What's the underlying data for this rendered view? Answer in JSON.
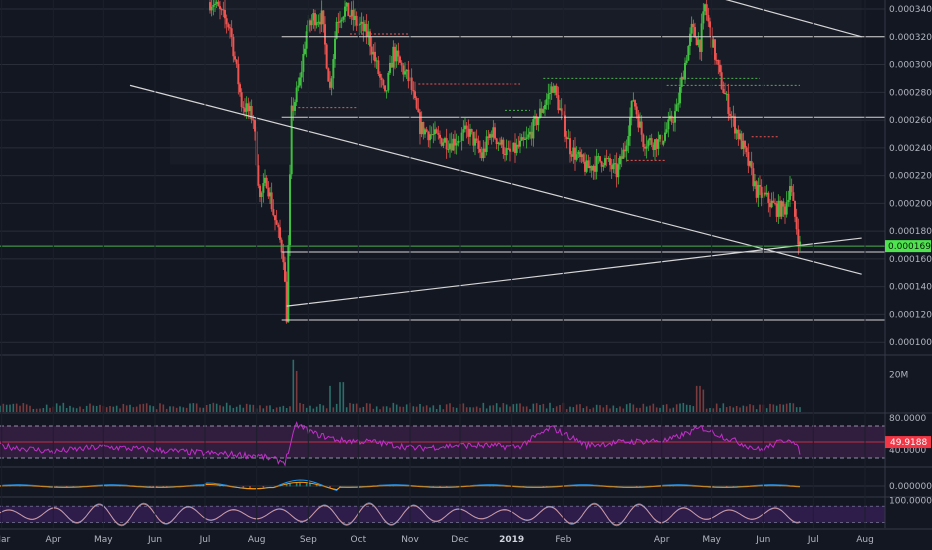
{
  "colors": {
    "background": "#131722",
    "panel_shade": "#181c27",
    "grid": "#2a2e39",
    "up": "#26a69a",
    "up_body": "#3fbf3f",
    "down": "#ef5350",
    "trendline": "#d6d6d6",
    "price_line": "#4caf50",
    "price_tag": "#4ee44e",
    "rsi_line": "#c130c9",
    "rsi_band": "#4a2356",
    "rsi_tag": "#f23645",
    "macd_line": "#2196f3",
    "signal_line": "#ff9800",
    "stoch_k": "#7b8ab8",
    "stoch_d": "#e0a0a0",
    "stoch_band": "#3b1f5c",
    "level_dotted_green": "#4caf50",
    "level_dotted_red": "#ef5350"
  },
  "chart_data": [
    {
      "type": "candlestick",
      "panel": "price",
      "y_ticks": [
        "0.0003400",
        "0.0003200",
        "0.0003000",
        "0.0002800",
        "0.0002600",
        "0.0002400",
        "0.0002200",
        "0.0002000",
        "0.0001800",
        "0.0001600",
        "0.0001400",
        "0.0001200",
        "0.0001000"
      ],
      "y_tick_values": [
        0.00034,
        0.00032,
        0.0003,
        0.00028,
        0.00026,
        0.00024,
        0.00022,
        0.0002,
        0.00018,
        0.00016,
        0.00014,
        0.00012,
        0.0001
      ],
      "ylim": [
        9.15e-05,
        0.0003465
      ],
      "current_price_label": "0.0001692",
      "current_price": 0.0001692,
      "close_series": [
        {
          "x": "2018-07-06",
          "y": 0.000345
        },
        {
          "x": "2018-07-16",
          "y": 0.000327
        },
        {
          "x": "2018-07-23",
          "y": 0.000272
        },
        {
          "x": "2018-07-30",
          "y": 0.000262
        },
        {
          "x": "2018-08-03",
          "y": 0.000203
        },
        {
          "x": "2018-08-07",
          "y": 0.000217
        },
        {
          "x": "2018-08-11",
          "y": 0.000193
        },
        {
          "x": "2018-08-17",
          "y": 0.000163
        },
        {
          "x": "2018-08-19",
          "y": 0.000119
        },
        {
          "x": "2018-08-22",
          "y": 0.000265
        },
        {
          "x": "2018-08-27",
          "y": 0.000288
        },
        {
          "x": "2018-08-31",
          "y": 0.000324
        },
        {
          "x": "2018-09-04",
          "y": 0.000334
        },
        {
          "x": "2018-09-09",
          "y": 0.000334
        },
        {
          "x": "2018-09-14",
          "y": 0.000282
        },
        {
          "x": "2018-09-18",
          "y": 0.000332
        },
        {
          "x": "2018-09-23",
          "y": 0.00034
        },
        {
          "x": "2018-09-30",
          "y": 0.00033
        },
        {
          "x": "2018-10-07",
          "y": 0.000321
        },
        {
          "x": "2018-10-17",
          "y": 0.000276
        },
        {
          "x": "2018-10-22",
          "y": 0.000309
        },
        {
          "x": "2018-11-01",
          "y": 0.000287
        },
        {
          "x": "2018-11-07",
          "y": 0.000255
        },
        {
          "x": "2018-11-17",
          "y": 0.000247
        },
        {
          "x": "2018-11-26",
          "y": 0.000244
        },
        {
          "x": "2018-12-06",
          "y": 0.000252
        },
        {
          "x": "2018-12-14",
          "y": 0.000234
        },
        {
          "x": "2018-12-20",
          "y": 0.000252
        },
        {
          "x": "2018-12-30",
          "y": 0.000235
        },
        {
          "x": "2019-01-10",
          "y": 0.000245
        },
        {
          "x": "2019-01-20",
          "y": 0.00027
        },
        {
          "x": "2019-01-26",
          "y": 0.000285
        },
        {
          "x": "2019-02-05",
          "y": 0.00024
        },
        {
          "x": "2019-02-15",
          "y": 0.000225
        },
        {
          "x": "2019-02-25",
          "y": 0.000232
        },
        {
          "x": "2019-03-05",
          "y": 0.000222
        },
        {
          "x": "2019-03-10",
          "y": 0.00024
        },
        {
          "x": "2019-03-15",
          "y": 0.000276
        },
        {
          "x": "2019-03-21",
          "y": 0.000245
        },
        {
          "x": "2019-03-31",
          "y": 0.000244
        },
        {
          "x": "2019-04-10",
          "y": 0.000267
        },
        {
          "x": "2019-04-14",
          "y": 0.000295
        },
        {
          "x": "2019-04-19",
          "y": 0.000325
        },
        {
          "x": "2019-04-24",
          "y": 0.000315
        },
        {
          "x": "2019-04-27",
          "y": 0.000342
        },
        {
          "x": "2019-05-01",
          "y": 0.000318
        },
        {
          "x": "2019-05-06",
          "y": 0.00029
        },
        {
          "x": "2019-05-13",
          "y": 0.000262
        },
        {
          "x": "2019-05-20",
          "y": 0.00024
        },
        {
          "x": "2019-05-24",
          "y": 0.000225
        },
        {
          "x": "2019-05-28",
          "y": 0.000209
        },
        {
          "x": "2019-06-03",
          "y": 0.000203
        },
        {
          "x": "2019-06-09",
          "y": 0.000196
        },
        {
          "x": "2019-06-14",
          "y": 0.000196
        },
        {
          "x": "2019-06-17",
          "y": 0.000214
        },
        {
          "x": "2019-06-19",
          "y": 0.000197
        },
        {
          "x": "2019-06-23",
          "y": 0.0001692
        }
      ],
      "horizontal_levels": [
        0.00032,
        0.000262,
        0.000165,
        0.000116
      ],
      "dotted_levels": [
        {
          "from": "2018-11-06",
          "to": "2019-01-06",
          "y": 0.000286,
          "color": "red"
        },
        {
          "from": "2018-12-28",
          "to": "2019-01-12",
          "y": 0.000267,
          "color": "green"
        },
        {
          "from": "2019-01-20",
          "to": "2019-05-30",
          "y": 0.00029,
          "color": "green"
        },
        {
          "from": "2019-04-04",
          "to": "2019-06-23",
          "y": 0.000285,
          "color": "green"
        },
        {
          "from": "2019-03-11",
          "to": "2019-04-04",
          "y": 0.000231,
          "color": "red"
        },
        {
          "from": "2018-08-26",
          "to": "2018-09-30",
          "y": 0.000269,
          "color": "red"
        },
        {
          "from": "2018-09-26",
          "to": "2018-10-31",
          "y": 0.000322,
          "color": "red"
        },
        {
          "from": "2019-05-25",
          "to": "2019-06-10",
          "y": 0.000248,
          "color": "red"
        }
      ],
      "trendlines": [
        {
          "from": {
            "x": "2018-05-17",
            "y": 0.000285
          },
          "to": {
            "x": "2019-07-30",
            "y": 0.000149
          }
        },
        {
          "from": {
            "x": "2018-08-19",
            "y": 0.000126
          },
          "to": {
            "x": "2019-07-30",
            "y": 0.000175
          }
        },
        {
          "from": {
            "x": "2019-05-06",
            "y": 0.000348
          },
          "to": {
            "x": "2019-07-30",
            "y": 0.00032
          }
        }
      ]
    },
    {
      "type": "bar",
      "panel": "volume",
      "y_ticks": [
        "20M"
      ],
      "y_tick_values": [
        20
      ],
      "ylim": [
        0,
        30
      ],
      "spikes": [
        {
          "x": "2018-08-23",
          "y": 28
        },
        {
          "x": "2018-08-25",
          "y": 22
        },
        {
          "x": "2018-09-14",
          "y": 14
        },
        {
          "x": "2018-09-21",
          "y": 16
        },
        {
          "x": "2019-04-23",
          "y": 14
        },
        {
          "x": "2019-04-26",
          "y": 12
        }
      ]
    },
    {
      "type": "line",
      "panel": "rsi",
      "y_ticks": [
        "80.0000",
        "40.0000"
      ],
      "y_tick_values": [
        80,
        40
      ],
      "band": [
        30,
        70
      ],
      "midline": 50,
      "ylim": [
        20,
        85
      ],
      "current_value_label": "49.9188",
      "current_value": 49.9188,
      "series": [
        {
          "x": "2018-03-01",
          "y": 45
        },
        {
          "x": "2018-04-01",
          "y": 38
        },
        {
          "x": "2018-05-01",
          "y": 44
        },
        {
          "x": "2018-06-01",
          "y": 40
        },
        {
          "x": "2018-07-01",
          "y": 36
        },
        {
          "x": "2018-08-01",
          "y": 33
        },
        {
          "x": "2018-08-18",
          "y": 25
        },
        {
          "x": "2018-08-25",
          "y": 72
        },
        {
          "x": "2018-09-05",
          "y": 60
        },
        {
          "x": "2018-09-20",
          "y": 52
        },
        {
          "x": "2018-10-10",
          "y": 50
        },
        {
          "x": "2018-11-05",
          "y": 42
        },
        {
          "x": "2018-12-01",
          "y": 46
        },
        {
          "x": "2019-01-05",
          "y": 44
        },
        {
          "x": "2019-01-25",
          "y": 68
        },
        {
          "x": "2019-02-15",
          "y": 46
        },
        {
          "x": "2019-03-10",
          "y": 50
        },
        {
          "x": "2019-04-05",
          "y": 52
        },
        {
          "x": "2019-04-25",
          "y": 68
        },
        {
          "x": "2019-05-10",
          "y": 55
        },
        {
          "x": "2019-05-30",
          "y": 40
        },
        {
          "x": "2019-06-17",
          "y": 55
        },
        {
          "x": "2019-06-23",
          "y": 38
        }
      ]
    },
    {
      "type": "line",
      "panel": "macd",
      "y_ticks": [
        "0.0000000"
      ],
      "y_tick_values": [
        0
      ],
      "ylim": [
        -1,
        1
      ]
    },
    {
      "type": "line",
      "panel": "stochastic",
      "y_ticks": [
        "100.0000"
      ],
      "y_tick_values": [
        100
      ],
      "ylim": [
        0,
        110
      ],
      "band": [
        20,
        80
      ]
    },
    {
      "type": "time_axis",
      "labels": [
        {
          "x": "2018-03-01",
          "label": "Mar"
        },
        {
          "x": "2018-04-01",
          "label": "Apr"
        },
        {
          "x": "2018-05-01",
          "label": "May"
        },
        {
          "x": "2018-06-01",
          "label": "Jun"
        },
        {
          "x": "2018-07-01",
          "label": "Jul"
        },
        {
          "x": "2018-08-01",
          "label": "Aug"
        },
        {
          "x": "2018-09-01",
          "label": "Sep"
        },
        {
          "x": "2018-10-01",
          "label": "Oct"
        },
        {
          "x": "2018-11-01",
          "label": "Nov"
        },
        {
          "x": "2018-12-01",
          "label": "Dec"
        },
        {
          "x": "2019-01-01",
          "label": "2019"
        },
        {
          "x": "2019-02-01",
          "label": "Feb"
        },
        {
          "x": "2019-04-01",
          "label": "Apr"
        },
        {
          "x": "2019-05-01",
          "label": "May"
        },
        {
          "x": "2019-06-01",
          "label": "Jun"
        },
        {
          "x": "2019-07-01",
          "label": "Jul"
        },
        {
          "x": "2019-08-01",
          "label": "Aug"
        }
      ],
      "xlim": [
        "2018-02-28",
        "2019-08-13"
      ]
    }
  ]
}
